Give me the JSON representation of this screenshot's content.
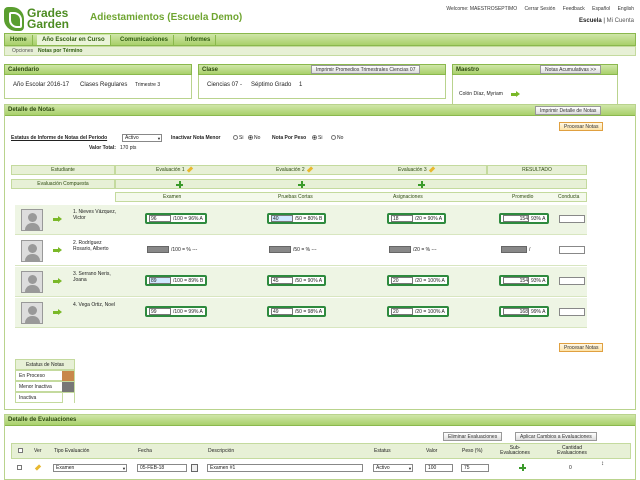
{
  "header": {
    "logo_line1": "Grades",
    "logo_line2": "Garden",
    "app_title": "Adiestamientos (Escuela Demo)",
    "welcome": "Welcome: MAESTROSEPTIMO",
    "links": [
      "Cerrar Sesión",
      "Feedback",
      "Español",
      "English"
    ],
    "school": "Escuela",
    "account": "Mi Cuenta"
  },
  "nav": {
    "items": [
      "Home",
      "Año Escolar en Curso",
      "Comunicaciones",
      "Informes"
    ],
    "sub": [
      "Opciones",
      "Notas por Término"
    ]
  },
  "calendario": {
    "title": "Calendario",
    "year": "Año Escolar 2016-17",
    "classes": "Clases Regulares",
    "term": "Trimestre 3"
  },
  "clase": {
    "title": "Clase",
    "print_button": "Imprimir Promedios Trimestrales Ciencias 07",
    "name": "Ciencias 07 -",
    "grade": "Séptimo Grado",
    "section": "1"
  },
  "maestro": {
    "title": "Maestro",
    "button": "Notas Acumulativas >>",
    "name": "Colón Díaz, Myriam"
  },
  "detalle": {
    "title": "Detalle de Notas",
    "print_button": "Imprimir Detalle de Notas",
    "process_button": "Procesar Notas",
    "status_label": "Estatus de Informe de Notas del Periodo",
    "status_value": "Activo",
    "inactivar_label": "Inactivar Nota Menor",
    "si": "Si",
    "no": "No",
    "peso_label": "Nota Por Peso",
    "valor_total_label": "Valor Total:",
    "valor_total": "170 pts",
    "col_estudiante": "Estudiante",
    "col_compuesta": "Evaluación Compuesta",
    "evaluations": [
      {
        "head": "Evaluación 1",
        "name": "Examen"
      },
      {
        "head": "Evaluación 2",
        "name": "Pruebas Cortas"
      },
      {
        "head": "Evaluación 3",
        "name": "Asignaciones"
      }
    ],
    "resultado": "RESULTADO",
    "promedio": "Promedio",
    "conducta": "Conducta",
    "students": [
      {
        "name": "1. Nieves Vázquez, Victor",
        "scores": [
          {
            "v": "96",
            "r": "/100 = 96% A"
          },
          {
            "v": "40",
            "r": "/50 = 80% B"
          },
          {
            "v": "18",
            "r": "/20 = 90% A"
          }
        ],
        "avg_v": "154",
        "avg_r": "93% A"
      },
      {
        "name": "2. Rodríguez Rosario, Alberto",
        "scores": [
          {
            "v": "",
            "r": "/100 = % ---"
          },
          {
            "v": "",
            "r": "/50 = % ---"
          },
          {
            "v": "",
            "r": "/20 = % ---"
          }
        ],
        "avg_v": "",
        "avg_r": "/"
      },
      {
        "name": "3. Serrano Neris, Joana",
        "scores": [
          {
            "v": "89",
            "r": "/100 = 89% B"
          },
          {
            "v": "45",
            "r": "/50 = 90% A"
          },
          {
            "v": "20",
            "r": "/20 = 100% A"
          }
        ],
        "avg_v": "154",
        "avg_r": "93% A"
      },
      {
        "name": "4. Vega Ortiz, Noel",
        "scores": [
          {
            "v": "99",
            "r": "/100 = 99% A"
          },
          {
            "v": "49",
            "r": "/50 = 98% A"
          },
          {
            "v": "20",
            "r": "/20 = 100% A"
          }
        ],
        "avg_v": "168",
        "avg_r": "99% A"
      }
    ],
    "process_button_bottom": "Procesar Notas"
  },
  "legend": {
    "title": "Estatus de Notas",
    "items": [
      {
        "label": "En Proceso",
        "color": "#c8874a"
      },
      {
        "label": "Menor Inactiva",
        "color": "#777777"
      },
      {
        "label": "Inactiva",
        "color": "#ffffff"
      }
    ]
  },
  "evaluaciones": {
    "title": "Detalle de Evaluaciones",
    "btn_remove": "Eliminar Evaluaciones",
    "btn_apply": "Aplicar Cambios a Evaluaciones",
    "cols": [
      "Ver",
      "Tipo Evaluación",
      "Fecha",
      "Descripción",
      "Estatus",
      "Valor",
      "Peso (%)",
      "Sub-Evaluaciones",
      "Cantidad Evaluaciones"
    ],
    "row": {
      "tipo": "Examen",
      "fecha": "05-FEB-18",
      "desc": "Examen #1",
      "estatus": "Activo",
      "valor": "100",
      "peso": "75",
      "cantidad": "0"
    }
  },
  "colors": {
    "accent_green": "#7ab828",
    "brand_green": "#4d8c22",
    "score_green": "#2e8a3e",
    "score_blue": "#5aa0e0"
  }
}
